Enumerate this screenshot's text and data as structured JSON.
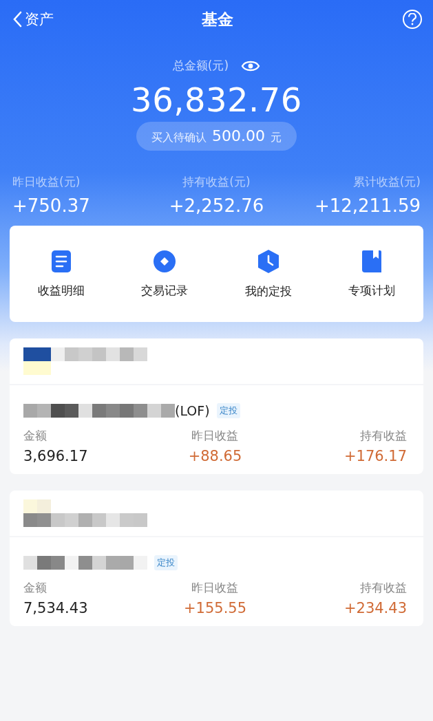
{
  "nav": {
    "back": "资产",
    "title": "基金"
  },
  "summary": {
    "label": "总金额(元)",
    "total": "36,832.76",
    "pending": {
      "label": "买入待确认",
      "amount": "500.00",
      "unit": "元"
    }
  },
  "stats": [
    {
      "label": "昨日收益(元)",
      "value": "+750.37"
    },
    {
      "label": "持有收益(元)",
      "value": "+2,252.76"
    },
    {
      "label": "累计收益(元)",
      "value": "+12,211.59"
    }
  ],
  "actions": [
    {
      "kind": "document",
      "label": "收益明细"
    },
    {
      "kind": "diamond",
      "label": "交易记录"
    },
    {
      "kind": "clock",
      "label": "我的定投"
    },
    {
      "kind": "bookmark",
      "label": "专项计划"
    }
  ],
  "funds": [
    {
      "kind": "blue",
      "name_suffix": "(LOF)",
      "tag": "定投",
      "metrics": [
        {
          "label": "金额",
          "value": "3,696.17",
          "kind": "plain"
        },
        {
          "label": "昨日收益",
          "value": "+88.65",
          "kind": "gain"
        },
        {
          "label": "持有收益",
          "value": "+176.17",
          "kind": "gain"
        }
      ]
    },
    {
      "kind": "yellow",
      "tag": "定投",
      "metrics": [
        {
          "label": "金额",
          "value": "7,534.43",
          "kind": "plain"
        },
        {
          "label": "昨日收益",
          "value": "+155.55",
          "kind": "gain"
        },
        {
          "label": "持有收益",
          "value": "+234.43",
          "kind": "gain"
        }
      ]
    }
  ]
}
